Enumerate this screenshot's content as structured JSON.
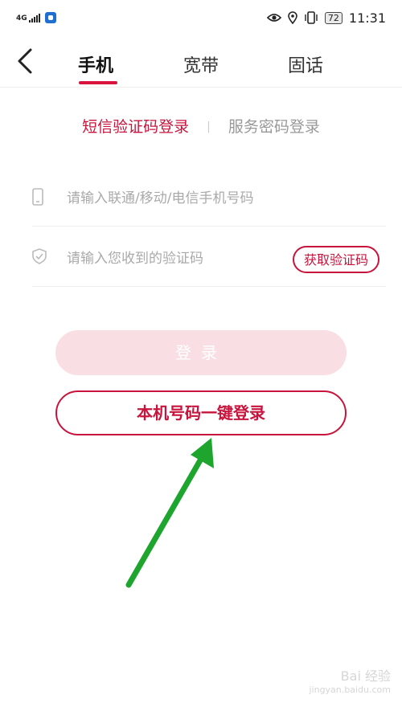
{
  "status_bar": {
    "network": "4G",
    "battery": "72",
    "time": "11:31",
    "icons": [
      "signal-icon",
      "app-notification-icon",
      "eye-icon",
      "location-icon",
      "vibrate-icon",
      "battery-icon"
    ]
  },
  "nav": {
    "tabs": [
      {
        "label": "手机",
        "active": true
      },
      {
        "label": "宽带",
        "active": false
      },
      {
        "label": "固话",
        "active": false
      }
    ]
  },
  "login_modes": {
    "sms": "短信验证码登录",
    "separator": "|",
    "password": "服务密码登录"
  },
  "form": {
    "phone_placeholder": "请输入联通/移动/电信手机号码",
    "code_placeholder": "请输入您收到的验证码",
    "get_code_label": "获取验证码"
  },
  "buttons": {
    "login": "登录",
    "one_key_login": "本机号码一键登录"
  },
  "watermark": {
    "text": "Bai 经验",
    "url": "jingyan.baidu.com"
  },
  "colors": {
    "accent": "#c8143c",
    "login_disabled_bg": "#f9dfe3",
    "annotation_arrow": "#1ea52e"
  }
}
